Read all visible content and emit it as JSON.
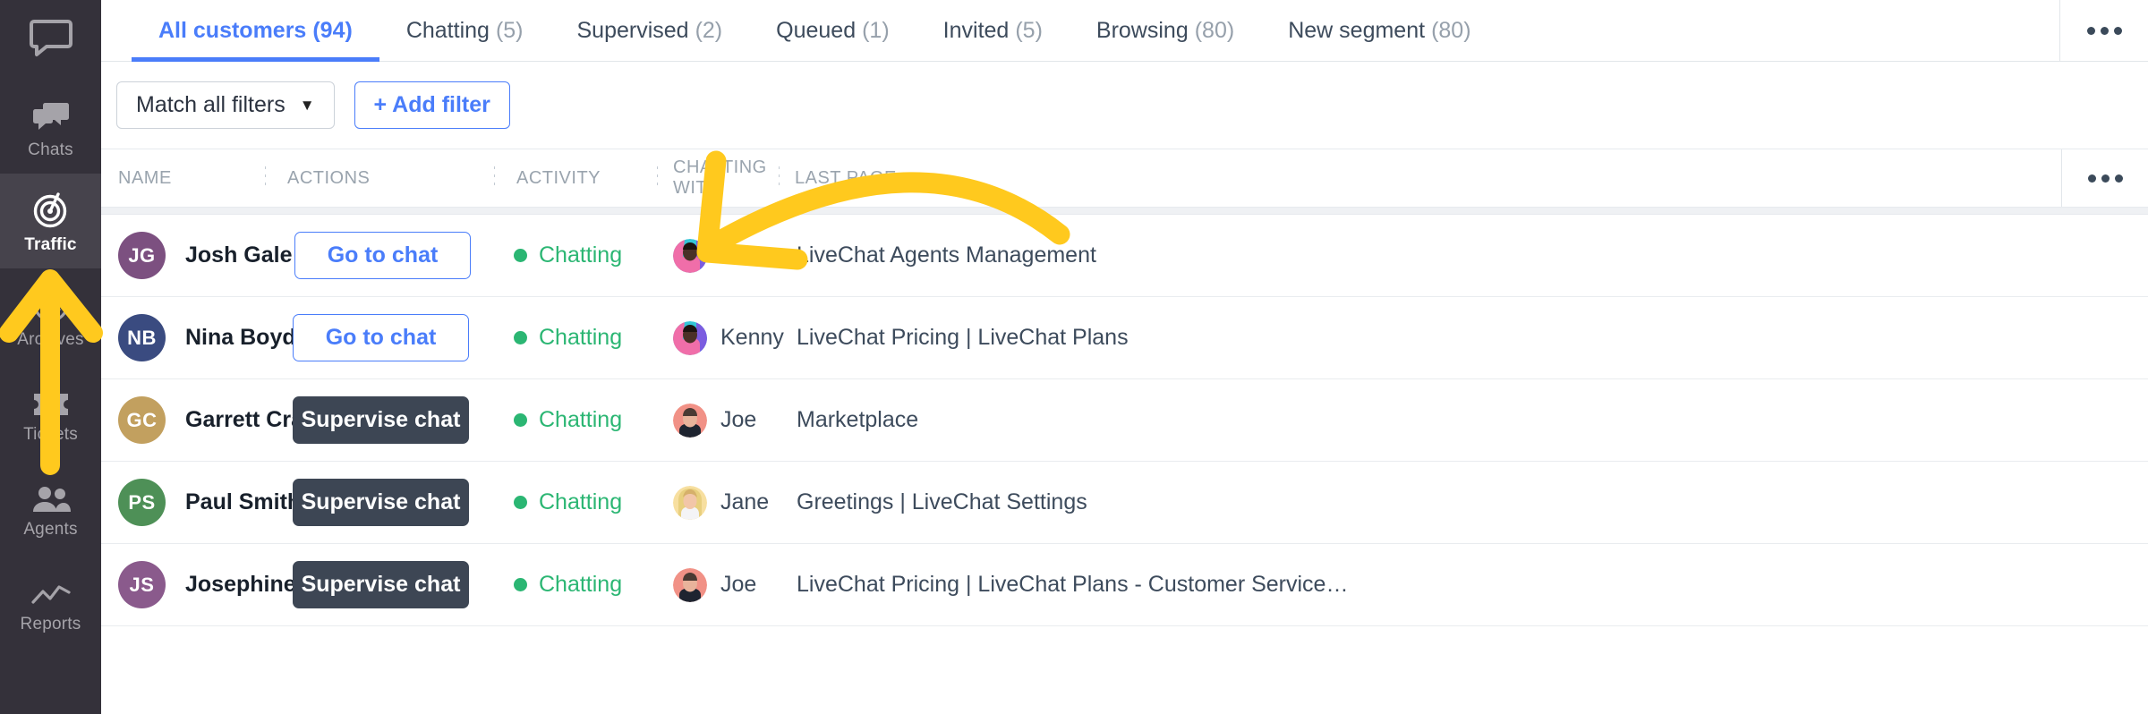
{
  "sidebar": {
    "logo_icon": "livechat-logo-icon",
    "items": [
      {
        "label": "Chats",
        "icon": "chats-icon",
        "active": false
      },
      {
        "label": "Traffic",
        "icon": "traffic-icon",
        "active": true
      },
      {
        "label": "Archives",
        "icon": "archives-icon",
        "active": false
      },
      {
        "label": "Tickets",
        "icon": "tickets-icon",
        "active": false
      },
      {
        "label": "Agents",
        "icon": "agents-icon",
        "active": false
      },
      {
        "label": "Reports",
        "icon": "reports-icon",
        "active": false
      }
    ]
  },
  "tabs": [
    {
      "label": "All customers",
      "count": "(94)",
      "active": true
    },
    {
      "label": "Chatting",
      "count": "(5)",
      "active": false
    },
    {
      "label": "Supervised",
      "count": "(2)",
      "active": false
    },
    {
      "label": "Queued",
      "count": "(1)",
      "active": false
    },
    {
      "label": "Invited",
      "count": "(5)",
      "active": false
    },
    {
      "label": "Browsing",
      "count": "(80)",
      "active": false
    },
    {
      "label": "New segment",
      "count": "(80)",
      "active": false
    }
  ],
  "tabbar": {
    "more_icon": "more-horizontal-icon"
  },
  "filters": {
    "match_label": "Match all filters",
    "match_caret": "▼",
    "add_filter_label": "+ Add filter"
  },
  "table": {
    "columns": [
      "NAME",
      "ACTIONS",
      "ACTIVITY",
      "CHATTING WITH",
      "LAST PAGE"
    ],
    "more_icon": "more-horizontal-icon",
    "rows": [
      {
        "initials": "JG",
        "avatar_color": "#7c5080",
        "name": "Josh Gale",
        "action_label": "Go to chat",
        "action_style": "outline",
        "activity": "Chatting",
        "activity_color": "#2bb673",
        "agent": "Kenny",
        "agent_avatar": "kenny",
        "last_page": "LiveChat Agents Management"
      },
      {
        "initials": "NB",
        "avatar_color": "#3a4b80",
        "name": "Nina Boyd",
        "action_label": "Go to chat",
        "action_style": "outline",
        "activity": "Chatting",
        "activity_color": "#2bb673",
        "agent": "Kenny",
        "agent_avatar": "kenny",
        "last_page": "LiveChat Pricing | LiveChat Plans"
      },
      {
        "initials": "GC",
        "avatar_color": "#c2a05f",
        "name": "Garrett Craig",
        "action_label": "Supervise chat",
        "action_style": "solid",
        "activity": "Chatting",
        "activity_color": "#2bb673",
        "agent": "Joe",
        "agent_avatar": "joe",
        "last_page": "Marketplace"
      },
      {
        "initials": "PS",
        "avatar_color": "#4e9057",
        "name": "Paul Smith",
        "action_label": "Supervise chat",
        "action_style": "solid",
        "activity": "Chatting",
        "activity_color": "#2bb673",
        "agent": "Jane",
        "agent_avatar": "jane",
        "last_page": "Greetings | LiveChat Settings"
      },
      {
        "initials": "JS",
        "avatar_color": "#8a5a8c",
        "name": "Josephine Spencer",
        "action_label": "Supervise chat",
        "action_style": "solid",
        "activity": "Chatting",
        "activity_color": "#2bb673",
        "agent": "Joe",
        "agent_avatar": "joe",
        "last_page": "LiveChat Pricing | LiveChat Plans - Customer Service…"
      }
    ]
  },
  "annotations": {
    "color": "#ffc91e",
    "arrow_up_target": "Traffic",
    "arrow_curve_target": "ACTIVITY"
  },
  "theme": {
    "accent_blue": "#4a7dfa",
    "sidebar_bg": "#34313a",
    "sidebar_active_bg": "#46434c",
    "dark_button": "#3d4654",
    "status_green": "#2bb673"
  }
}
